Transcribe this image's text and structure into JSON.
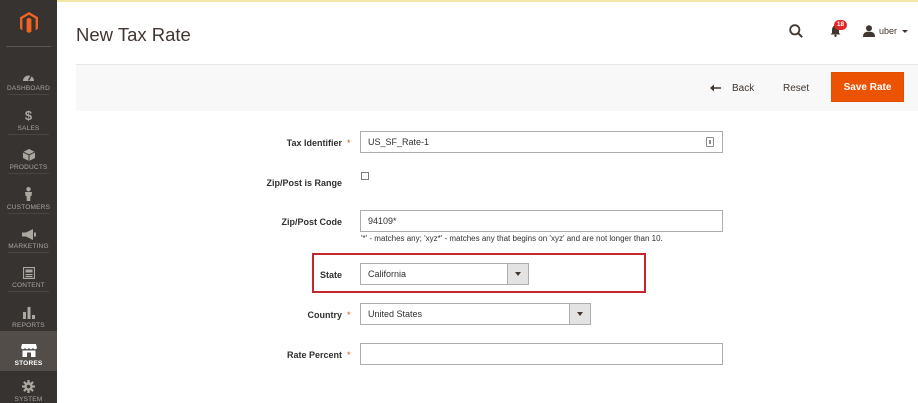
{
  "sidebar": {
    "items": [
      {
        "label": "DASHBOARD",
        "icon": "gauge-icon",
        "active": false
      },
      {
        "label": "SALES",
        "icon": "dollar-icon",
        "active": false
      },
      {
        "label": "PRODUCTS",
        "icon": "cube-icon",
        "active": false
      },
      {
        "label": "CUSTOMERS",
        "icon": "person-icon",
        "active": false
      },
      {
        "label": "MARKETING",
        "icon": "megaphone-icon",
        "active": false
      },
      {
        "label": "CONTENT",
        "icon": "content-icon",
        "active": false
      },
      {
        "label": "REPORTS",
        "icon": "bar-chart-icon",
        "active": false
      },
      {
        "label": "STORES",
        "icon": "store-icon",
        "active": true
      },
      {
        "label": "SYSTEM",
        "icon": "gear-icon",
        "active": false
      }
    ]
  },
  "header": {
    "title": "New Tax Rate",
    "notifications_count": "18",
    "user_name": "uber"
  },
  "actions": {
    "back_label": "Back",
    "reset_label": "Reset",
    "save_label": "Save Rate"
  },
  "form": {
    "tax_identifier": {
      "label": "Tax Identifier",
      "value": "US_SF_Rate-1",
      "required": true
    },
    "zip_is_range": {
      "label": "Zip/Post is Range",
      "checked": false
    },
    "zip_code": {
      "label": "Zip/Post Code",
      "value": "94109*",
      "note": "'*' - matches any; 'xyz*' - matches any that begins on 'xyz' and are not longer than 10."
    },
    "state": {
      "label": "State",
      "value": "California"
    },
    "country": {
      "label": "Country",
      "value": "United States",
      "required": true
    },
    "rate_percent": {
      "label": "Rate Percent",
      "value": "",
      "required": true
    }
  },
  "colors": {
    "sidebar_bg": "#373330",
    "accent": "#eb5202",
    "highlight": "#c4262e",
    "badge": "#e22626"
  }
}
